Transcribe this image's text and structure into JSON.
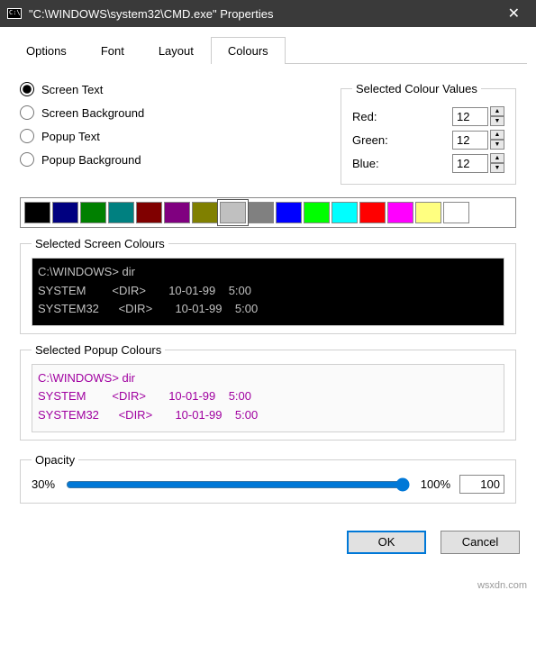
{
  "title": "\"C:\\WINDOWS\\system32\\CMD.exe\" Properties",
  "tabs": [
    "Options",
    "Font",
    "Layout",
    "Colours"
  ],
  "active_tab": "Colours",
  "radios": {
    "screen_text": "Screen Text",
    "screen_bg": "Screen Background",
    "popup_text": "Popup Text",
    "popup_bg": "Popup Background",
    "selected": "screen_text"
  },
  "colour_values": {
    "legend": "Selected Colour Values",
    "red_label": "Red:",
    "red_value": "12",
    "green_label": "Green:",
    "green_value": "12",
    "blue_label": "Blue:",
    "blue_value": "12"
  },
  "palette": [
    {
      "hex": "#000000",
      "selected": false
    },
    {
      "hex": "#000080",
      "selected": false
    },
    {
      "hex": "#008000",
      "selected": false
    },
    {
      "hex": "#008080",
      "selected": false
    },
    {
      "hex": "#800000",
      "selected": false
    },
    {
      "hex": "#800080",
      "selected": false
    },
    {
      "hex": "#808000",
      "selected": false
    },
    {
      "hex": "#c0c0c0",
      "selected": true
    },
    {
      "hex": "#808080",
      "selected": false
    },
    {
      "hex": "#0000ff",
      "selected": false
    },
    {
      "hex": "#00ff00",
      "selected": false
    },
    {
      "hex": "#00ffff",
      "selected": false
    },
    {
      "hex": "#ff0000",
      "selected": false
    },
    {
      "hex": "#ff00ff",
      "selected": false
    },
    {
      "hex": "#ffff80",
      "selected": false
    },
    {
      "hex": "#ffffff",
      "selected": false
    }
  ],
  "screen_preview": {
    "legend": "Selected Screen Colours",
    "line1": "C:\\WINDOWS> dir",
    "line2": "SYSTEM        <DIR>       10-01-99    5:00",
    "line3": "SYSTEM32      <DIR>       10-01-99    5:00"
  },
  "popup_preview": {
    "legend": "Selected Popup Colours",
    "line1": "C:\\WINDOWS> dir",
    "line2": "SYSTEM        <DIR>       10-01-99    5:00",
    "line3": "SYSTEM32      <DIR>       10-01-99    5:00"
  },
  "opacity": {
    "legend": "Opacity",
    "min_label": "30%",
    "max_label": "100%",
    "value": "100"
  },
  "buttons": {
    "ok": "OK",
    "cancel": "Cancel"
  },
  "watermark": "wsxdn.com"
}
